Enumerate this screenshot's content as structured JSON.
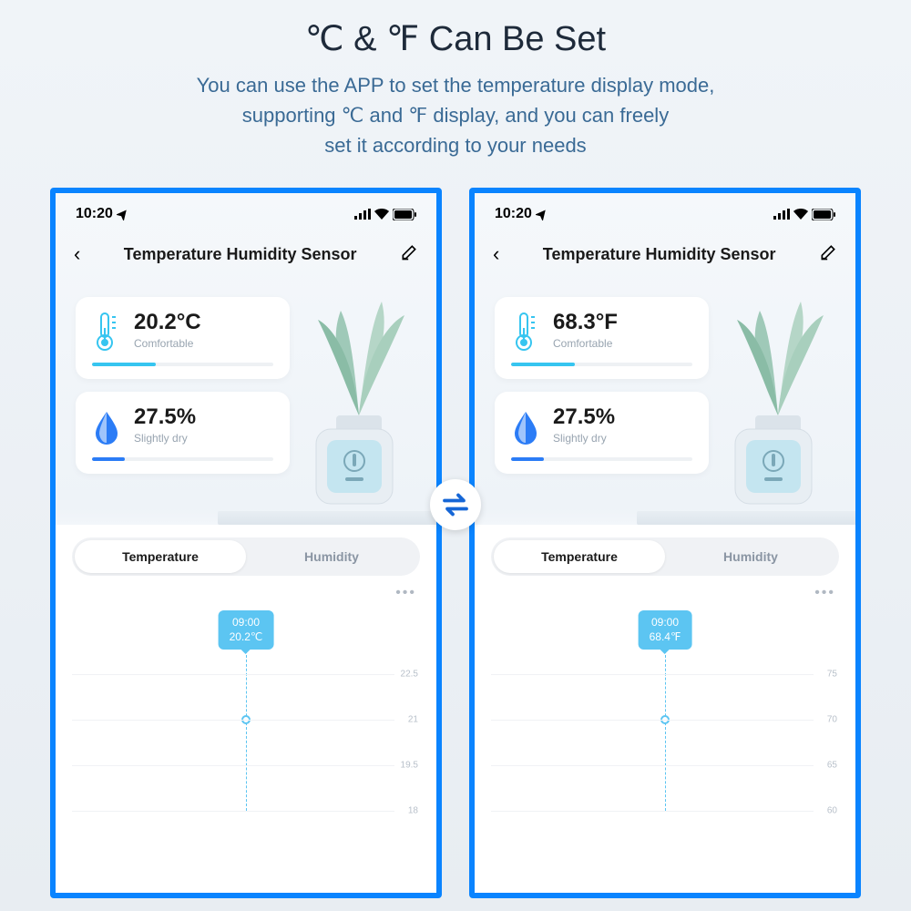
{
  "header": {
    "title": "℃ & ℉ Can Be Set",
    "subtitle_line1": "You can use the APP to set the temperature display mode,",
    "subtitle_line2": "supporting ℃ and ℉ display, and you can freely",
    "subtitle_line3": "set it according to your needs"
  },
  "status_bar": {
    "time": "10:20"
  },
  "nav": {
    "title": "Temperature Humidity Sensor"
  },
  "phone_left": {
    "temp_value": "20.2°C",
    "temp_label": "Comfortable",
    "hum_value": "27.5%",
    "hum_label": "Slightly dry",
    "tooltip_time": "09:00",
    "tooltip_value": "20.2℃",
    "y_ticks": [
      "22.5",
      "21",
      "19.5",
      "18"
    ]
  },
  "phone_right": {
    "temp_value": "68.3°F",
    "temp_label": "Comfortable",
    "hum_value": "27.5%",
    "hum_label": "Slightly dry",
    "tooltip_time": "09:00",
    "tooltip_value": "68.4℉",
    "y_ticks": [
      "75",
      "70",
      "65",
      "60"
    ]
  },
  "tabs": {
    "temperature": "Temperature",
    "humidity": "Humidity"
  },
  "colors": {
    "frame": "#0a84ff",
    "accent": "#5cc5f2"
  },
  "chart_data": [
    {
      "type": "line",
      "title": "Temperature (°C)",
      "x": [
        "09:00"
      ],
      "values": [
        20.2
      ],
      "ylim": [
        18,
        22.5
      ],
      "y_ticks": [
        22.5,
        21,
        19.5,
        18
      ],
      "xlabel": "",
      "ylabel": ""
    },
    {
      "type": "line",
      "title": "Temperature (°F)",
      "x": [
        "09:00"
      ],
      "values": [
        68.4
      ],
      "ylim": [
        60,
        75
      ],
      "y_ticks": [
        75,
        70,
        65,
        60
      ],
      "xlabel": "",
      "ylabel": ""
    }
  ]
}
